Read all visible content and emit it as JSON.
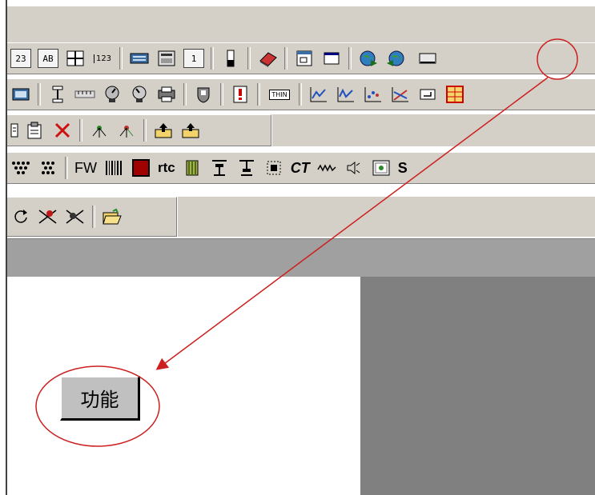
{
  "toolbar1": {
    "items": [
      {
        "name": "text-123-icon",
        "label": "23"
      },
      {
        "name": "text-ab-icon",
        "label": "AB"
      },
      {
        "name": "grid-icon",
        "label": ""
      },
      {
        "name": "number-123-icon",
        "label": "123"
      },
      {
        "name": "keyboard-icon",
        "label": ""
      },
      {
        "name": "calculator-icon",
        "label": ""
      },
      {
        "name": "number-1-icon",
        "label": "1"
      },
      {
        "name": "slider-icon",
        "label": ""
      },
      {
        "name": "eraser-icon",
        "label": ""
      },
      {
        "name": "window-frame-icon",
        "label": ""
      },
      {
        "name": "window-icon",
        "label": ""
      },
      {
        "name": "globe-forward-icon",
        "label": ""
      },
      {
        "name": "globe-back-icon",
        "label": ""
      },
      {
        "name": "button-control-icon",
        "label": ""
      }
    ]
  },
  "toolbar2": {
    "items": [
      {
        "name": "display-icon"
      },
      {
        "name": "tower-icon"
      },
      {
        "name": "ruler-icon"
      },
      {
        "name": "gauge-icon"
      },
      {
        "name": "gauge-alt-icon"
      },
      {
        "name": "printer-icon"
      },
      {
        "name": "shield-icon"
      },
      {
        "name": "alarm-doc-icon"
      },
      {
        "name": "thing-icon",
        "label": "THIN"
      },
      {
        "name": "trend-chart-icon"
      },
      {
        "name": "trend-chart-alt-icon"
      },
      {
        "name": "scatter-chart-icon"
      },
      {
        "name": "xy-chart-icon"
      },
      {
        "name": "enter-icon"
      },
      {
        "name": "table-icon"
      }
    ]
  },
  "toolbar3": {
    "items": [
      {
        "name": "list-icon"
      },
      {
        "name": "properties-icon"
      },
      {
        "name": "delete-x-icon"
      },
      {
        "name": "network-icon"
      },
      {
        "name": "network-alt-icon"
      },
      {
        "name": "import-icon"
      },
      {
        "name": "export-icon"
      }
    ]
  },
  "toolbar4": {
    "items": [
      {
        "name": "dots-pattern-icon"
      },
      {
        "name": "dots-grid-icon"
      },
      {
        "name": "fw-text",
        "label": "FW"
      },
      {
        "name": "barcode-icon"
      },
      {
        "name": "red-square-icon"
      },
      {
        "name": "rtc-text",
        "label": "rtc"
      },
      {
        "name": "database-icon"
      },
      {
        "name": "align-top-icon"
      },
      {
        "name": "align-bottom-icon"
      },
      {
        "name": "target-box-icon"
      },
      {
        "name": "ct-text",
        "label": "CT"
      },
      {
        "name": "wave-icon"
      },
      {
        "name": "speaker-icon"
      },
      {
        "name": "image-icon"
      },
      {
        "name": "s-text",
        "label": "S"
      }
    ]
  },
  "toolbar5": {
    "items": [
      {
        "name": "rotate-icon"
      },
      {
        "name": "connect-icon"
      },
      {
        "name": "disconnect-icon"
      },
      {
        "name": "open-folder-icon"
      }
    ]
  },
  "canvas": {
    "function_button_label": "功能"
  },
  "colors": {
    "annotation": "#cc1f1f",
    "toolbar_bg": "#d4d0c8",
    "canvas_gray": "#808080",
    "status_strip": "#a0a0a0"
  }
}
